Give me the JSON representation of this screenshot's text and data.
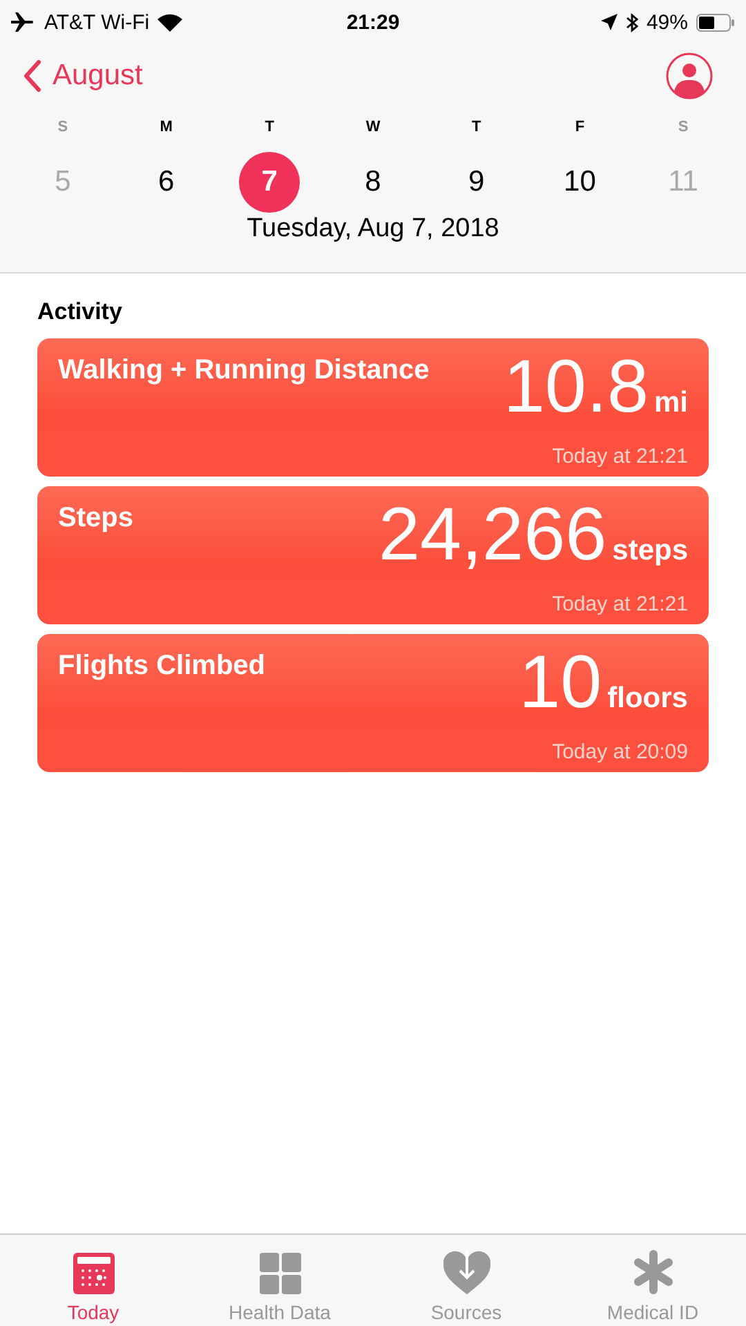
{
  "status_bar": {
    "carrier": "AT&T Wi-Fi",
    "time": "21:29",
    "battery": "49%"
  },
  "nav": {
    "back_label": "August"
  },
  "week": [
    {
      "letter": "S",
      "day": "5",
      "dimmed": true,
      "selected": false
    },
    {
      "letter": "M",
      "day": "6",
      "dimmed": false,
      "selected": false
    },
    {
      "letter": "T",
      "day": "7",
      "dimmed": false,
      "selected": true
    },
    {
      "letter": "W",
      "day": "8",
      "dimmed": false,
      "selected": false
    },
    {
      "letter": "T",
      "day": "9",
      "dimmed": false,
      "selected": false
    },
    {
      "letter": "F",
      "day": "10",
      "dimmed": false,
      "selected": false
    },
    {
      "letter": "S",
      "day": "11",
      "dimmed": true,
      "selected": false
    }
  ],
  "date_label": "Tuesday, Aug 7, 2018",
  "section_title": "Activity",
  "cards": [
    {
      "title": "Walking + Running Distance",
      "value": "10.8",
      "unit": "mi",
      "time": "Today at 21:21"
    },
    {
      "title": "Steps",
      "value": "24,266",
      "unit": "steps",
      "time": "Today at 21:21"
    },
    {
      "title": "Flights Climbed",
      "value": "10",
      "unit": "floors",
      "time": "Today at 20:09"
    }
  ],
  "tabs": [
    {
      "label": "Today",
      "kind": "today",
      "selected": true
    },
    {
      "label": "Health Data",
      "kind": "grid",
      "selected": false
    },
    {
      "label": "Sources",
      "kind": "sources",
      "selected": false
    },
    {
      "label": "Medical ID",
      "kind": "medical",
      "selected": false
    }
  ]
}
